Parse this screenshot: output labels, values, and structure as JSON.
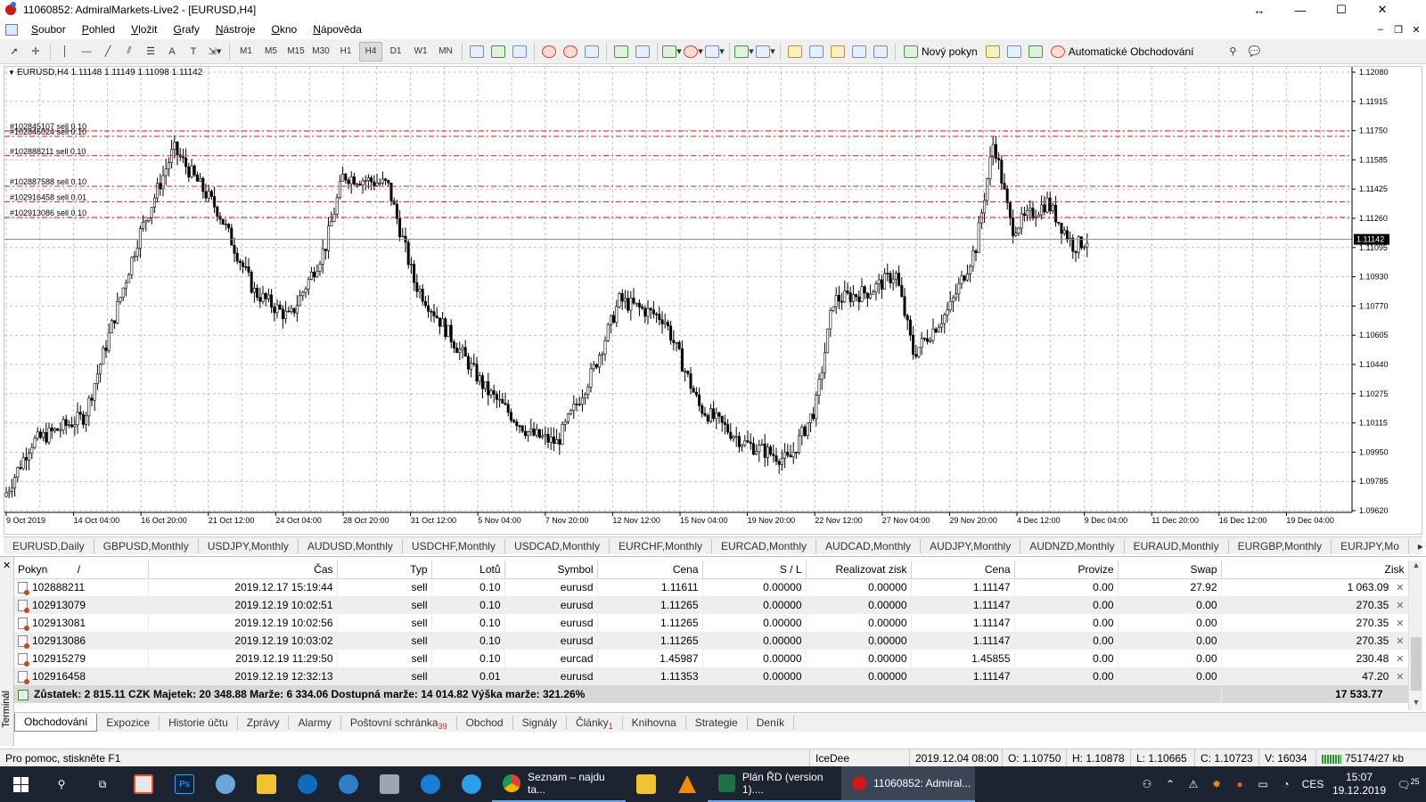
{
  "window": {
    "title": "11060852: AdmiralMarkets-Live2 - [EURUSD,H4]",
    "controls": {
      "restore": "↔",
      "minimize": "—",
      "maximize": "☐",
      "close": "✕"
    }
  },
  "menu": {
    "items": [
      "Soubor",
      "Pohled",
      "Vložit",
      "Grafy",
      "Nástroje",
      "Okno",
      "Nápověda"
    ],
    "mdi": {
      "minimize": "–",
      "restore": "❐",
      "close": "✕"
    }
  },
  "toolbar": {
    "timeframes": [
      "M1",
      "M5",
      "M15",
      "M30",
      "H1",
      "H4",
      "D1",
      "W1",
      "MN"
    ],
    "active_timeframe": "H4",
    "new_order_label": "Nový pokyn",
    "auto_trading_label": "Automatické Obchodování"
  },
  "chart": {
    "header": "EURUSD,H4  1.11148 1.11149 1.11098 1.11142",
    "current_price": "1.11142",
    "price_axis": [
      "1.12080",
      "1.11915",
      "1.11750",
      "1.11585",
      "1.11425",
      "1.11260",
      "1.11095",
      "1.10930",
      "1.10770",
      "1.10605",
      "1.10440",
      "1.10275",
      "1.10115",
      "1.09950",
      "1.09785",
      "1.09620"
    ],
    "time_axis": [
      "9 Oct 2019",
      "14 Oct 04:00",
      "16 Oct 20:00",
      "21 Oct 12:00",
      "24 Oct 04:00",
      "28 Oct 20:00",
      "31 Oct 12:00",
      "5 Nov 04:00",
      "7 Nov 20:00",
      "12 Nov 12:00",
      "15 Nov 04:00",
      "19 Nov 20:00",
      "22 Nov 12:00",
      "27 Nov 04:00",
      "29 Nov 20:00",
      "4 Dec 12:00",
      "9 Dec 04:00",
      "11 Dec 20:00",
      "16 Dec 12:00",
      "19 Dec 04:00"
    ],
    "order_lines": [
      {
        "label": "#102845107 sell 0.10",
        "price": 1.1175
      },
      {
        "label": "#102846024 sell 0.10",
        "price": 1.1172
      },
      {
        "label": "#102888211 sell 0.10",
        "price": 1.11611
      },
      {
        "label": "#102887588 sell 0.10",
        "price": 1.1144
      },
      {
        "label": "#102916458 sell 0.01",
        "price": 1.11353
      },
      {
        "label": "#102913086 sell 0.10",
        "price": 1.11265
      }
    ],
    "colors": {
      "order_line": "#e8141a",
      "candle": "#000000",
      "grid": "#c0c0c0",
      "price_tag_bg": "#000000"
    }
  },
  "symbol_tabs": [
    "EURUSD,Daily",
    "GBPUSD,Monthly",
    "USDJPY,Monthly",
    "AUDUSD,Monthly",
    "USDCHF,Monthly",
    "USDCAD,Monthly",
    "EURCHF,Monthly",
    "EURCAD,Monthly",
    "AUDCAD,Monthly",
    "AUDJPY,Monthly",
    "AUDNZD,Monthly",
    "EURAUD,Monthly",
    "EURGBP,Monthly",
    "EURJPY,Mo"
  ],
  "terminal": {
    "side_label": "Terminál",
    "columns": [
      "Pokyn",
      "Čas",
      "Typ",
      "Lotů",
      "Symbol",
      "Cena",
      "S / L",
      "Realizovat zisk",
      "Cena",
      "Provize",
      "Swap",
      "Zisk"
    ],
    "sort_mark": "/",
    "rows": [
      {
        "order": "102888211",
        "time": "2019.12.17 15:19:44",
        "type": "sell",
        "lots": "0.10",
        "symbol": "eurusd",
        "price": "1.11611",
        "sl": "0.00000",
        "tp": "0.00000",
        "cur_price": "1.11147",
        "commission": "0.00",
        "swap": "27.92",
        "profit": "1 063.09"
      },
      {
        "order": "102913079",
        "time": "2019.12.19 10:02:51",
        "type": "sell",
        "lots": "0.10",
        "symbol": "eurusd",
        "price": "1.11265",
        "sl": "0.00000",
        "tp": "0.00000",
        "cur_price": "1.11147",
        "commission": "0.00",
        "swap": "0.00",
        "profit": "270.35"
      },
      {
        "order": "102913081",
        "time": "2019.12.19 10:02:56",
        "type": "sell",
        "lots": "0.10",
        "symbol": "eurusd",
        "price": "1.11265",
        "sl": "0.00000",
        "tp": "0.00000",
        "cur_price": "1.11147",
        "commission": "0.00",
        "swap": "0.00",
        "profit": "270.35"
      },
      {
        "order": "102913086",
        "time": "2019.12.19 10:03:02",
        "type": "sell",
        "lots": "0.10",
        "symbol": "eurusd",
        "price": "1.11265",
        "sl": "0.00000",
        "tp": "0.00000",
        "cur_price": "1.11147",
        "commission": "0.00",
        "swap": "0.00",
        "profit": "270.35"
      },
      {
        "order": "102915279",
        "time": "2019.12.19 11:29:50",
        "type": "sell",
        "lots": "0.10",
        "symbol": "eurcad",
        "price": "1.45987",
        "sl": "0.00000",
        "tp": "0.00000",
        "cur_price": "1.45855",
        "commission": "0.00",
        "swap": "0.00",
        "profit": "230.48"
      },
      {
        "order": "102916458",
        "time": "2019.12.19 12:32:13",
        "type": "sell",
        "lots": "0.01",
        "symbol": "eurusd",
        "price": "1.11353",
        "sl": "0.00000",
        "tp": "0.00000",
        "cur_price": "1.11147",
        "commission": "0.00",
        "swap": "0.00",
        "profit": "47.20"
      }
    ],
    "summary": "Zůstatek: 2 815.11 CZK  Majetek: 20 348.88  Marže: 6 334.06  Dostupná marže: 14 014.82  Výška marže: 321.26%",
    "total_profit": "17 533.77",
    "tabs": [
      {
        "label": "Obchodování",
        "badge": ""
      },
      {
        "label": "Expozice",
        "badge": ""
      },
      {
        "label": "Historie účtu",
        "badge": ""
      },
      {
        "label": "Zprávy",
        "badge": ""
      },
      {
        "label": "Alarmy",
        "badge": ""
      },
      {
        "label": "Poštovní schránka",
        "badge": "39"
      },
      {
        "label": "Obchod",
        "badge": ""
      },
      {
        "label": "Signály",
        "badge": ""
      },
      {
        "label": "Články",
        "badge": "1"
      },
      {
        "label": "Knihovna",
        "badge": ""
      },
      {
        "label": "Strategie",
        "badge": ""
      },
      {
        "label": "Deník",
        "badge": ""
      }
    ],
    "active_tab": "Obchodování"
  },
  "statusbar": {
    "help": "Pro pomoc, stiskněte F1",
    "profile": "IceDee",
    "datetime": "2019.12.04 08:00",
    "open": "O: 1.10750",
    "high": "H: 1.10878",
    "low": "L: 1.10665",
    "close": "C: 1.10723",
    "volume": "V: 16034",
    "traffic": "75174/27 kb"
  },
  "taskbar": {
    "chrome_label": "Seznam – najdu ta...",
    "excel_label": "Plán ŘD (version 1)....",
    "mt4_label": "11060852: Admiral...",
    "language": "CES",
    "time": "15:07",
    "date": "19.12.2019",
    "notifications": "25"
  }
}
